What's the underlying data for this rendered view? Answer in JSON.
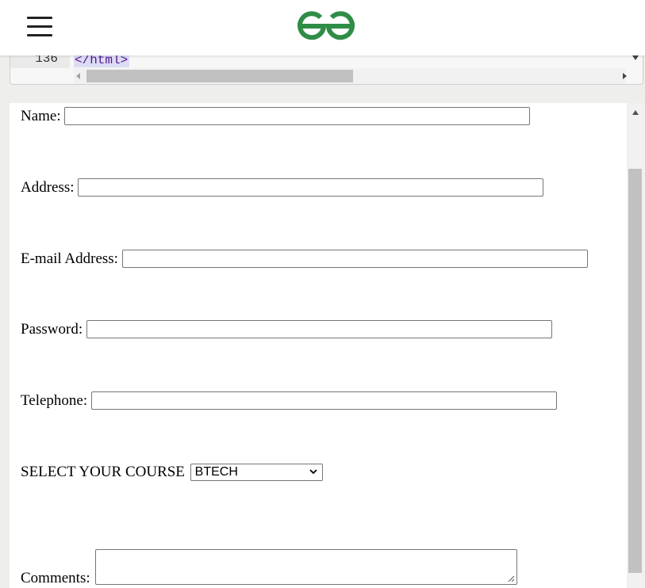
{
  "header": {
    "menu_icon": "hamburger-menu-icon",
    "logo": "geeksforgeeks-logo",
    "brand_color": "#2f8d46"
  },
  "editor": {
    "line_number": "136",
    "code": "</html>"
  },
  "form": {
    "name_label": "Name:",
    "name_value": "",
    "address_label": "Address:",
    "address_value": "",
    "email_label": "E-mail Address:",
    "email_value": "",
    "password_label": "Password:",
    "password_value": "",
    "telephone_label": "Telephone:",
    "telephone_value": "",
    "course_label": "SELECT YOUR COURSE",
    "course_selected": "BTECH",
    "comments_label": "Comments:",
    "comments_value": ""
  }
}
